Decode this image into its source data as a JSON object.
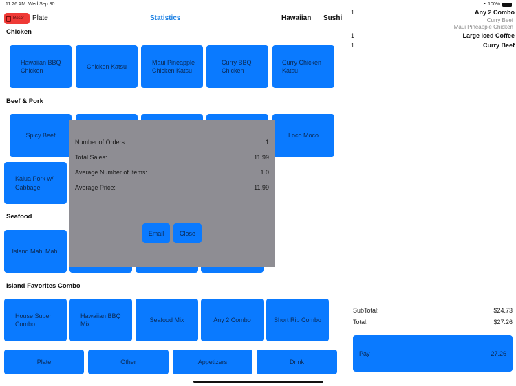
{
  "status_bar": {
    "time": "11:26 AM",
    "date": "Wed Sep 30",
    "wifi_icon": "wifi-icon",
    "battery": "100%",
    "battery_icon": "battery-icon"
  },
  "header": {
    "reset_label": "Reset",
    "reset_icon": "trash-icon",
    "title": "Plate",
    "statistics_label": "Statistics",
    "tabs": [
      {
        "label": "Hawaiian",
        "active": true
      },
      {
        "label": "Sushi",
        "active": false
      }
    ]
  },
  "sections": [
    {
      "title": "Chicken",
      "items": [
        "Hawaiian BBQ Chicken",
        "Chicken Katsu",
        "Maui Pineapple Chicken Katsu",
        "Curry BBQ Chicken",
        "Curry Chicken Katsu"
      ]
    },
    {
      "title": "Beef & Pork",
      "items": [
        "Spicy Beef",
        "",
        "",
        "",
        "Loco Moco",
        "Kalua Pork w/ Cabbage"
      ]
    },
    {
      "title": "Seafood",
      "items": [
        "Island Mahi Mahi",
        "",
        "",
        ""
      ]
    },
    {
      "title": "Island Favorites Combo",
      "items": [
        "House Super Combo",
        "Hawaiian BBQ Mix",
        "Seafood Mix",
        "Any 2 Combo",
        "Short Rib Combo"
      ]
    }
  ],
  "categories": [
    "Plate",
    "Other",
    "Appetizers",
    "Drink"
  ],
  "order": {
    "items": [
      {
        "qty": "1",
        "name": "Any 2 Combo",
        "subitems": [
          "Curry Beef",
          "Maui Pineapple Chicken"
        ]
      },
      {
        "qty": "1",
        "name": "Large Iced Coffee",
        "subitems": []
      },
      {
        "qty": "1",
        "name": "Curry Beef",
        "subitems": []
      }
    ],
    "subtotal_label": "SubTotal:",
    "subtotal": "$24.73",
    "total_label": "Total:",
    "total": "$27.26",
    "pay_label": "Pay",
    "pay_amount": "27.26"
  },
  "statistics_modal": {
    "rows": [
      {
        "label": "Number of Orders:",
        "value": "1"
      },
      {
        "label": "Total Sales:",
        "value": "11.99"
      },
      {
        "label": "Average Number of Items:",
        "value": "1.0"
      },
      {
        "label": "Average Price:",
        "value": "11.99"
      }
    ],
    "email_label": "Email",
    "close_label": "Close"
  },
  "colors": {
    "accent": "#0a7aff",
    "reset": "#ef3a36",
    "modal_bg": "#8e8d93",
    "link": "#1a7fe3"
  }
}
